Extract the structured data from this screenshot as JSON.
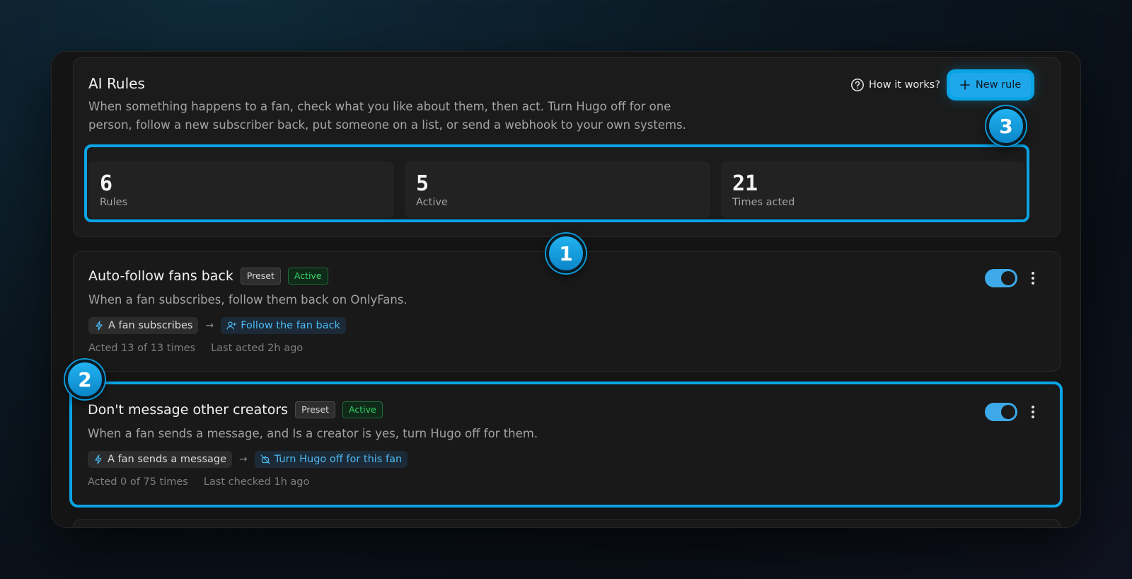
{
  "header": {
    "title": "AI Rules",
    "description": "When something happens to a fan, check what you like about them, then act. Turn Hugo off for one person, follow a new subscriber back, put someone on a list, or send a webhook to your own systems.",
    "how_label": "How it works?",
    "new_rule_label": "New rule"
  },
  "stats": [
    {
      "value": "6",
      "label": "Rules"
    },
    {
      "value": "5",
      "label": "Active"
    },
    {
      "value": "21",
      "label": "Times acted"
    }
  ],
  "rules": [
    {
      "title": "Auto-follow fans back",
      "preset": "Preset",
      "status": "Active",
      "description": "When a fan subscribes, follow them back on OnlyFans.",
      "trigger": "A fan subscribes",
      "action": "Follow the fan back",
      "acted": "Acted 13 of 13 times",
      "last": "Last acted 2h ago"
    },
    {
      "title": "Don't message other creators",
      "preset": "Preset",
      "status": "Active",
      "description": "When a fan sends a message, and Is a creator is yes, turn Hugo off for them.",
      "trigger": "A fan sends a message",
      "action": "Turn Hugo off for this fan",
      "acted": "Acted 0 of 75 times",
      "last": "Last checked 1h ago"
    }
  ],
  "callouts": [
    "1",
    "2",
    "3"
  ],
  "colors": {
    "accent": "#0aa4e6",
    "active_green": "#34d36a",
    "action_blue": "#4db8f2"
  }
}
